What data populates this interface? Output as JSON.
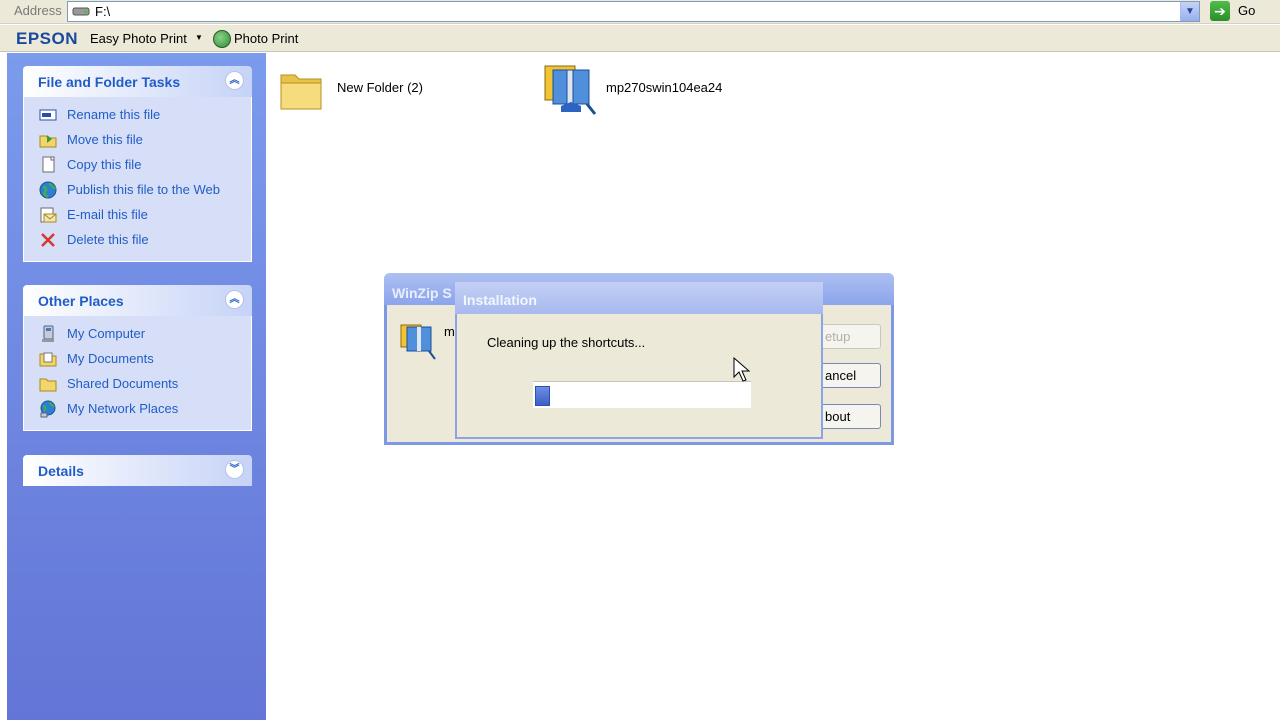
{
  "address_bar": {
    "label": "Address",
    "path": "F:\\",
    "go_label": "Go"
  },
  "epson_toolbar": {
    "logo": "EPSON",
    "easy_photo_print": "Easy Photo Print",
    "photo_print": "Photo Print"
  },
  "task_pane": {
    "file_tasks": {
      "title": "File and Folder Tasks",
      "items": [
        {
          "label": "Rename this file",
          "icon": "rename-icon"
        },
        {
          "label": "Move this file",
          "icon": "move-icon"
        },
        {
          "label": "Copy this file",
          "icon": "copy-icon"
        },
        {
          "label": "Publish this file to the Web",
          "icon": "globe-icon"
        },
        {
          "label": "E-mail this file",
          "icon": "email-icon"
        },
        {
          "label": "Delete this file",
          "icon": "delete-icon"
        }
      ]
    },
    "other_places": {
      "title": "Other Places",
      "items": [
        {
          "label": "My Computer",
          "icon": "computer-icon"
        },
        {
          "label": "My Documents",
          "icon": "documents-icon"
        },
        {
          "label": "Shared Documents",
          "icon": "folder-icon"
        },
        {
          "label": "My Network Places",
          "icon": "network-icon"
        }
      ]
    },
    "details": {
      "title": "Details"
    }
  },
  "files": [
    {
      "name": "New Folder (2)",
      "icon": "folder-icon"
    },
    {
      "name": "mp270swin104ea24",
      "icon": "winzip-icon"
    }
  ],
  "winzip_dialog": {
    "title": "WinZip S",
    "message_fragment": "m",
    "buttons": {
      "setup": "etup",
      "cancel": "ancel",
      "about": "bout"
    }
  },
  "installation_dialog": {
    "title": "Installation",
    "message": "Cleaning up the shortcuts...",
    "progress_fraction": 0.07
  },
  "colors": {
    "taskpane_top": "#7b9bec",
    "taskpane_bottom": "#6375d6",
    "link_blue": "#215dc6",
    "progress_blue": "#3c5fc9"
  }
}
